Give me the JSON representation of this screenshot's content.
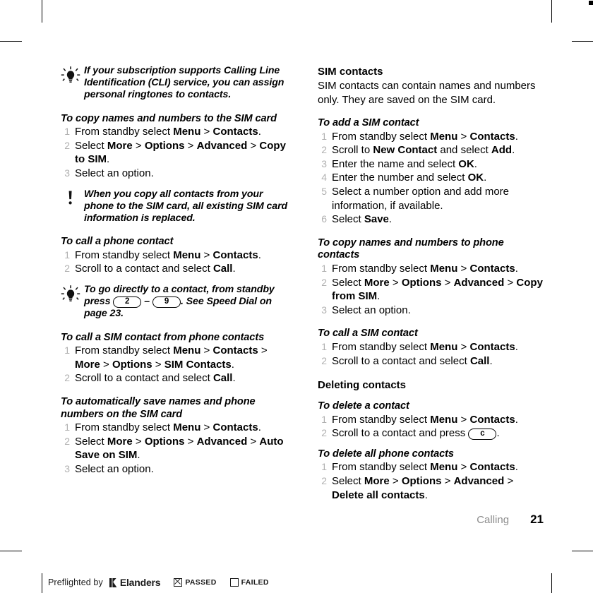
{
  "document": {
    "footer": {
      "chapter": "Calling",
      "page_number": "21"
    }
  },
  "left_column": {
    "tip1": {
      "icon": "lightbulb-icon",
      "text": "If your subscription supports Calling Line Identification (CLI) service, you can assign personal ringtones to contacts."
    },
    "proc_copy_to_sim": {
      "heading": "To copy names and numbers to the SIM card",
      "steps": [
        {
          "num": "1",
          "parts": [
            {
              "t": "From standby select ",
              "b": false
            },
            {
              "t": "Menu",
              "b": true
            },
            {
              "t": " > ",
              "b": false
            },
            {
              "t": "Contacts",
              "b": true
            },
            {
              "t": ".",
              "b": false
            }
          ]
        },
        {
          "num": "2",
          "parts": [
            {
              "t": "Select ",
              "b": false
            },
            {
              "t": "More",
              "b": true
            },
            {
              "t": " > ",
              "b": false
            },
            {
              "t": "Options",
              "b": true
            },
            {
              "t": " > ",
              "b": false
            },
            {
              "t": "Advanced",
              "b": true
            },
            {
              "t": " > ",
              "b": false
            },
            {
              "t": "Copy to SIM",
              "b": true
            },
            {
              "t": ".",
              "b": false
            }
          ]
        },
        {
          "num": "3",
          "parts": [
            {
              "t": "Select an option.",
              "b": false
            }
          ]
        }
      ]
    },
    "note1": {
      "icon": "exclamation-icon",
      "text": "When you copy all contacts from your phone to the SIM card, all existing SIM card information is replaced."
    },
    "proc_call_phone_contact": {
      "heading": "To call a phone contact",
      "steps": [
        {
          "num": "1",
          "parts": [
            {
              "t": "From standby select ",
              "b": false
            },
            {
              "t": "Menu",
              "b": true
            },
            {
              "t": " > ",
              "b": false
            },
            {
              "t": "Contacts",
              "b": true
            },
            {
              "t": ".",
              "b": false
            }
          ]
        },
        {
          "num": "2",
          "parts": [
            {
              "t": "Scroll to a contact and select ",
              "b": false
            },
            {
              "t": "Call",
              "b": true
            },
            {
              "t": ".",
              "b": false
            }
          ]
        }
      ]
    },
    "tip2": {
      "icon": "lightbulb-icon",
      "text_before": "To go directly to a contact, from standby press ",
      "key_low": "2",
      "dash": "–",
      "key_high": "9",
      "text_after": ". See Speed Dial on page 23."
    },
    "proc_call_sim_from_phone": {
      "heading": "To call a SIM contact from phone contacts",
      "steps": [
        {
          "num": "1",
          "parts": [
            {
              "t": "From standby select ",
              "b": false
            },
            {
              "t": "Menu",
              "b": true
            },
            {
              "t": " > ",
              "b": false
            },
            {
              "t": "Contacts",
              "b": true
            },
            {
              "t": " > ",
              "b": false
            },
            {
              "t": "More",
              "b": true
            },
            {
              "t": " > ",
              "b": false
            },
            {
              "t": "Options",
              "b": true
            },
            {
              "t": " > ",
              "b": false
            },
            {
              "t": "SIM Contacts",
              "b": true
            },
            {
              "t": ".",
              "b": false
            }
          ]
        },
        {
          "num": "2",
          "parts": [
            {
              "t": "Scroll to a contact and select ",
              "b": false
            },
            {
              "t": "Call",
              "b": true
            },
            {
              "t": ".",
              "b": false
            }
          ]
        }
      ]
    },
    "proc_auto_save": {
      "heading": "To automatically save names and phone numbers on the SIM card",
      "steps": [
        {
          "num": "1",
          "parts": [
            {
              "t": "From standby select ",
              "b": false
            },
            {
              "t": "Menu",
              "b": true
            },
            {
              "t": " > ",
              "b": false
            },
            {
              "t": "Contacts",
              "b": true
            },
            {
              "t": ".",
              "b": false
            }
          ]
        },
        {
          "num": "2",
          "parts": [
            {
              "t": "Select ",
              "b": false
            },
            {
              "t": "More",
              "b": true
            },
            {
              "t": " > ",
              "b": false
            },
            {
              "t": "Options",
              "b": true
            },
            {
              "t": " > ",
              "b": false
            },
            {
              "t": "Advanced",
              "b": true
            },
            {
              "t": " > ",
              "b": false
            },
            {
              "t": "Auto Save on SIM",
              "b": true
            },
            {
              "t": ".",
              "b": false
            }
          ]
        },
        {
          "num": "3",
          "parts": [
            {
              "t": "Select an option.",
              "b": false
            }
          ]
        }
      ]
    }
  },
  "right_column": {
    "section_sim_contacts": {
      "heading": "SIM contacts",
      "body": "SIM contacts can contain names and numbers only. They are saved on the SIM card."
    },
    "proc_add_sim_contact": {
      "heading": "To add a SIM contact",
      "steps": [
        {
          "num": "1",
          "parts": [
            {
              "t": "From standby select ",
              "b": false
            },
            {
              "t": "Menu",
              "b": true
            },
            {
              "t": " > ",
              "b": false
            },
            {
              "t": "Contacts",
              "b": true
            },
            {
              "t": ".",
              "b": false
            }
          ]
        },
        {
          "num": "2",
          "parts": [
            {
              "t": "Scroll to ",
              "b": false
            },
            {
              "t": "New Contact",
              "b": true
            },
            {
              "t": " and select ",
              "b": false
            },
            {
              "t": "Add",
              "b": true
            },
            {
              "t": ".",
              "b": false
            }
          ]
        },
        {
          "num": "3",
          "parts": [
            {
              "t": "Enter the name and select ",
              "b": false
            },
            {
              "t": "OK",
              "b": true
            },
            {
              "t": ".",
              "b": false
            }
          ]
        },
        {
          "num": "4",
          "parts": [
            {
              "t": "Enter the number and select ",
              "b": false
            },
            {
              "t": "OK",
              "b": true
            },
            {
              "t": ".",
              "b": false
            }
          ]
        },
        {
          "num": "5",
          "parts": [
            {
              "t": "Select a number option and add more information, if available.",
              "b": false
            }
          ]
        },
        {
          "num": "6",
          "parts": [
            {
              "t": "Select ",
              "b": false
            },
            {
              "t": "Save",
              "b": true
            },
            {
              "t": ".",
              "b": false
            }
          ]
        }
      ]
    },
    "proc_copy_from_sim": {
      "heading": "To copy names and numbers to phone contacts",
      "steps": [
        {
          "num": "1",
          "parts": [
            {
              "t": "From standby select ",
              "b": false
            },
            {
              "t": "Menu",
              "b": true
            },
            {
              "t": " > ",
              "b": false
            },
            {
              "t": "Contacts",
              "b": true
            },
            {
              "t": ".",
              "b": false
            }
          ]
        },
        {
          "num": "2",
          "parts": [
            {
              "t": "Select ",
              "b": false
            },
            {
              "t": "More",
              "b": true
            },
            {
              "t": " > ",
              "b": false
            },
            {
              "t": "Options",
              "b": true
            },
            {
              "t": " > ",
              "b": false
            },
            {
              "t": "Advanced",
              "b": true
            },
            {
              "t": " > ",
              "b": false
            },
            {
              "t": "Copy from SIM",
              "b": true
            },
            {
              "t": ".",
              "b": false
            }
          ]
        },
        {
          "num": "3",
          "parts": [
            {
              "t": "Select an option.",
              "b": false
            }
          ]
        }
      ]
    },
    "proc_call_sim_contact": {
      "heading": "To call a SIM contact",
      "steps": [
        {
          "num": "1",
          "parts": [
            {
              "t": "From standby select ",
              "b": false
            },
            {
              "t": "Menu",
              "b": true
            },
            {
              "t": " > ",
              "b": false
            },
            {
              "t": "Contacts",
              "b": true
            },
            {
              "t": ".",
              "b": false
            }
          ]
        },
        {
          "num": "2",
          "parts": [
            {
              "t": "Scroll to a contact and select ",
              "b": false
            },
            {
              "t": "Call",
              "b": true
            },
            {
              "t": ".",
              "b": false
            }
          ]
        }
      ]
    },
    "section_deleting": {
      "heading": "Deleting contacts"
    },
    "proc_delete_contact": {
      "heading": "To delete a contact",
      "step1": {
        "num": "1",
        "parts": [
          {
            "t": "From standby select ",
            "b": false
          },
          {
            "t": "Menu",
            "b": true
          },
          {
            "t": " > ",
            "b": false
          },
          {
            "t": "Contacts",
            "b": true
          },
          {
            "t": ".",
            "b": false
          }
        ]
      },
      "step2": {
        "num": "2",
        "text_before": "Scroll to a contact and press ",
        "key": "c",
        "text_after": "."
      }
    },
    "proc_delete_all": {
      "heading": "To delete all phone contacts",
      "steps": [
        {
          "num": "1",
          "parts": [
            {
              "t": "From standby select ",
              "b": false
            },
            {
              "t": "Menu",
              "b": true
            },
            {
              "t": " > ",
              "b": false
            },
            {
              "t": "Contacts",
              "b": true
            },
            {
              "t": ".",
              "b": false
            }
          ]
        },
        {
          "num": "2",
          "parts": [
            {
              "t": "Select ",
              "b": false
            },
            {
              "t": "More",
              "b": true
            },
            {
              "t": " > ",
              "b": false
            },
            {
              "t": "Options",
              "b": true
            },
            {
              "t": " > ",
              "b": false
            },
            {
              "t": "Advanced",
              "b": true
            },
            {
              "t": " > ",
              "b": false
            },
            {
              "t": "Delete all contacts",
              "b": true
            },
            {
              "t": ".",
              "b": false
            }
          ]
        }
      ]
    }
  },
  "preflight_bar": {
    "label": "Preflighted by",
    "brand": "Elanders",
    "passed_label": "PASSED",
    "passed_checked": true,
    "failed_label": "FAILED",
    "failed_checked": false
  }
}
